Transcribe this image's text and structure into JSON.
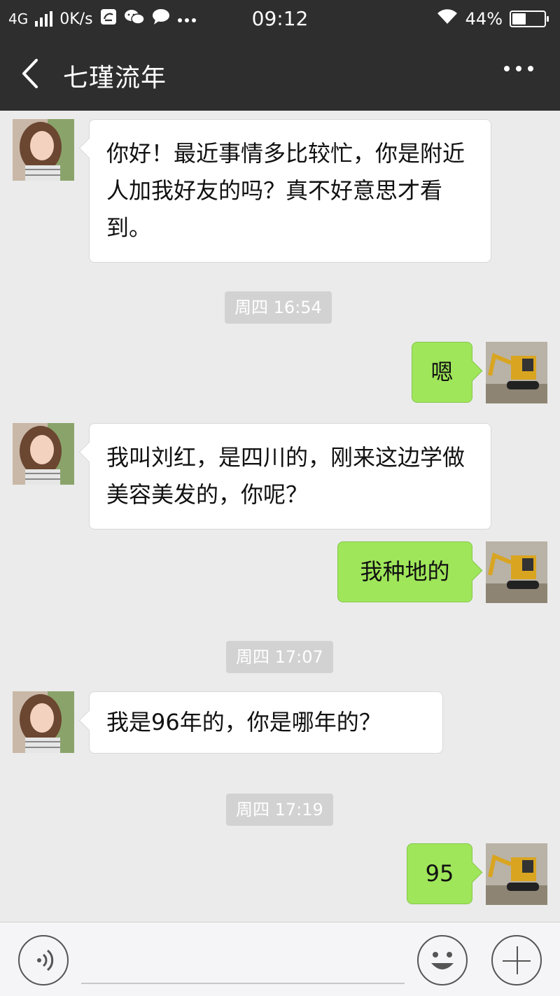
{
  "status_bar": {
    "network": "4G",
    "speed": "0K/s",
    "time": "09:12",
    "battery": "44%",
    "battery_level": 0.44
  },
  "header": {
    "title": "七瑾流年",
    "back_icon": "chevron-left-icon",
    "more_icon": "more-dots-icon"
  },
  "messages": [
    {
      "text": "你好！最近事情多比较忙，你是附近人加我好友的吗？真不好意思才看到。"
    },
    {
      "time": "周四 16:54"
    },
    {
      "text": "嗯"
    },
    {
      "text": "我叫刘红，是四川的，刚来这边学做美容美发的，你呢？"
    },
    {
      "text": "我种地的"
    },
    {
      "time": "周四 17:07"
    },
    {
      "text": "我是96年的，你是哪年的？"
    },
    {
      "time": "周四 17:19"
    },
    {
      "text": "95"
    }
  ],
  "input_bar": {
    "voice_icon": "voice-icon",
    "emoji_icon": "emoji-icon",
    "plus_icon": "plus-icon"
  },
  "colors": {
    "header_bg": "#2e2e2e",
    "chat_bg": "#ebebeb",
    "outgoing_bubble": "#9fe65a",
    "incoming_bubble": "#ffffff"
  }
}
